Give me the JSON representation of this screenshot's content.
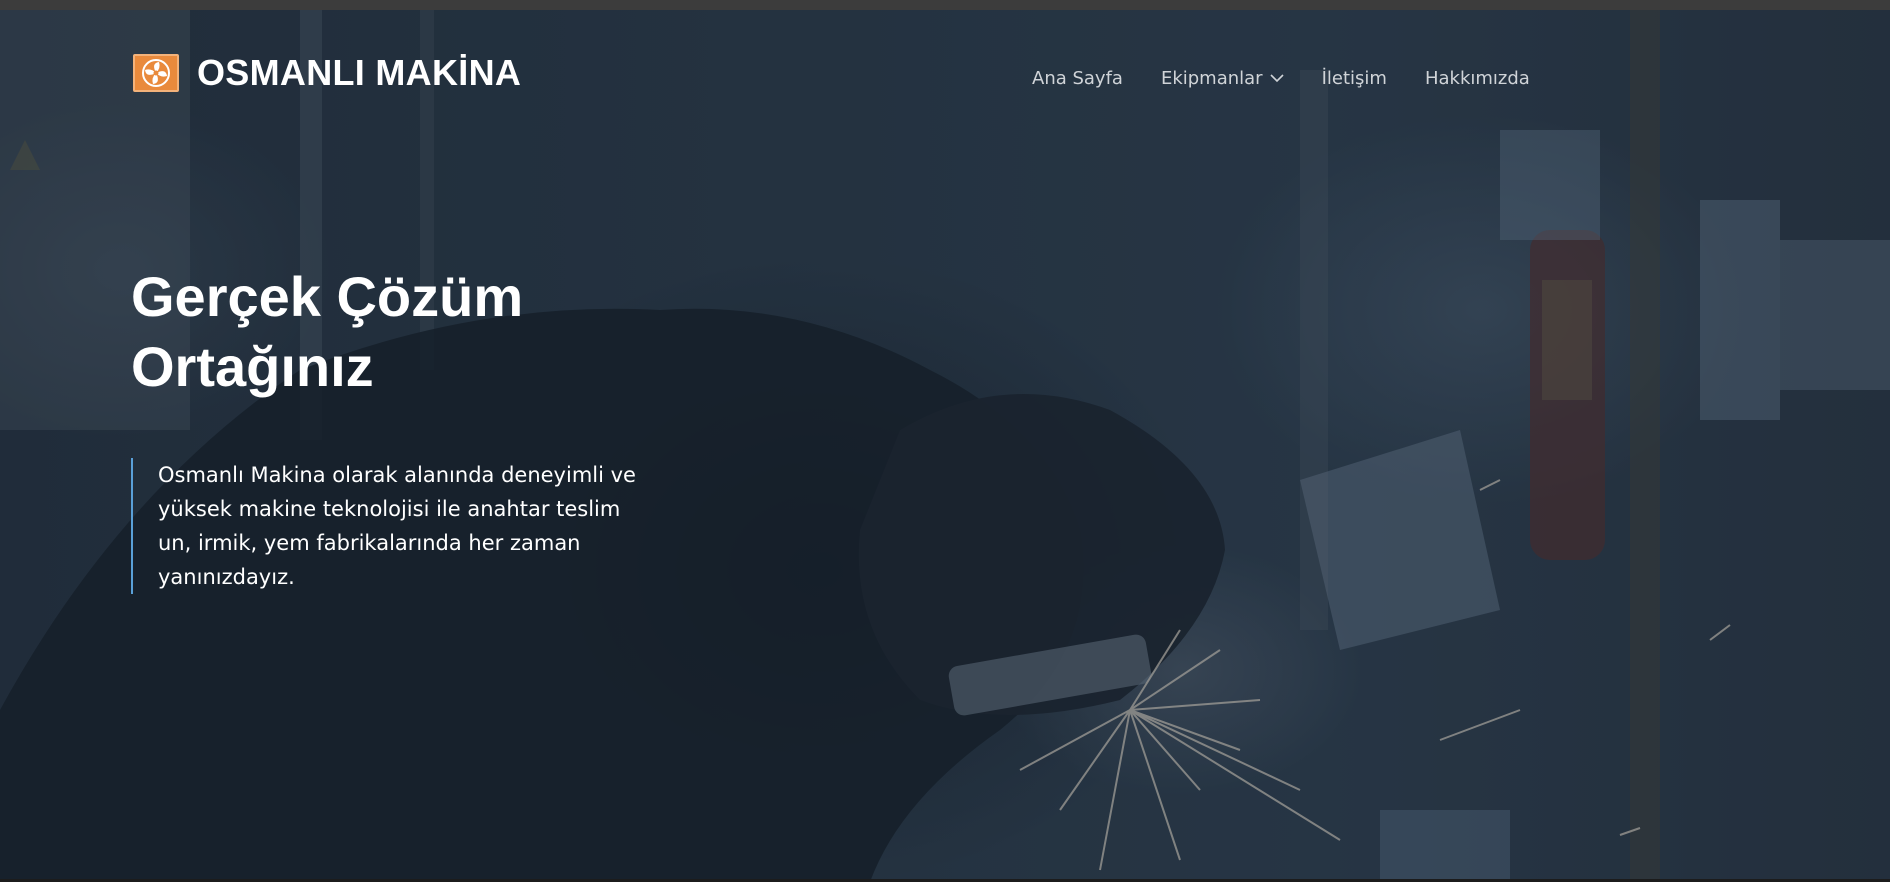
{
  "brand": {
    "name": "OSMANLI MAKİNA",
    "logo_icon": "fan-icon",
    "logo_color": "#e98a3c"
  },
  "nav": {
    "items": [
      {
        "label": "Ana Sayfa"
      },
      {
        "label": "Ekipmanlar",
        "icon": "chevron-down-icon"
      },
      {
        "label": "İletişim"
      },
      {
        "label": "Hakkımızda"
      }
    ]
  },
  "hero": {
    "headline": "Gerçek Çözüm Ortağınız",
    "intro": "Osmanlı Makina olarak alanında deneyimli ve yüksek makine teknolojisi ile anahtar teslim un, irmik, yem fabrikalarında her zaman yanınızdayız.",
    "accent_color": "#5aa0d8",
    "background_image": "welder-sparks-photo"
  }
}
